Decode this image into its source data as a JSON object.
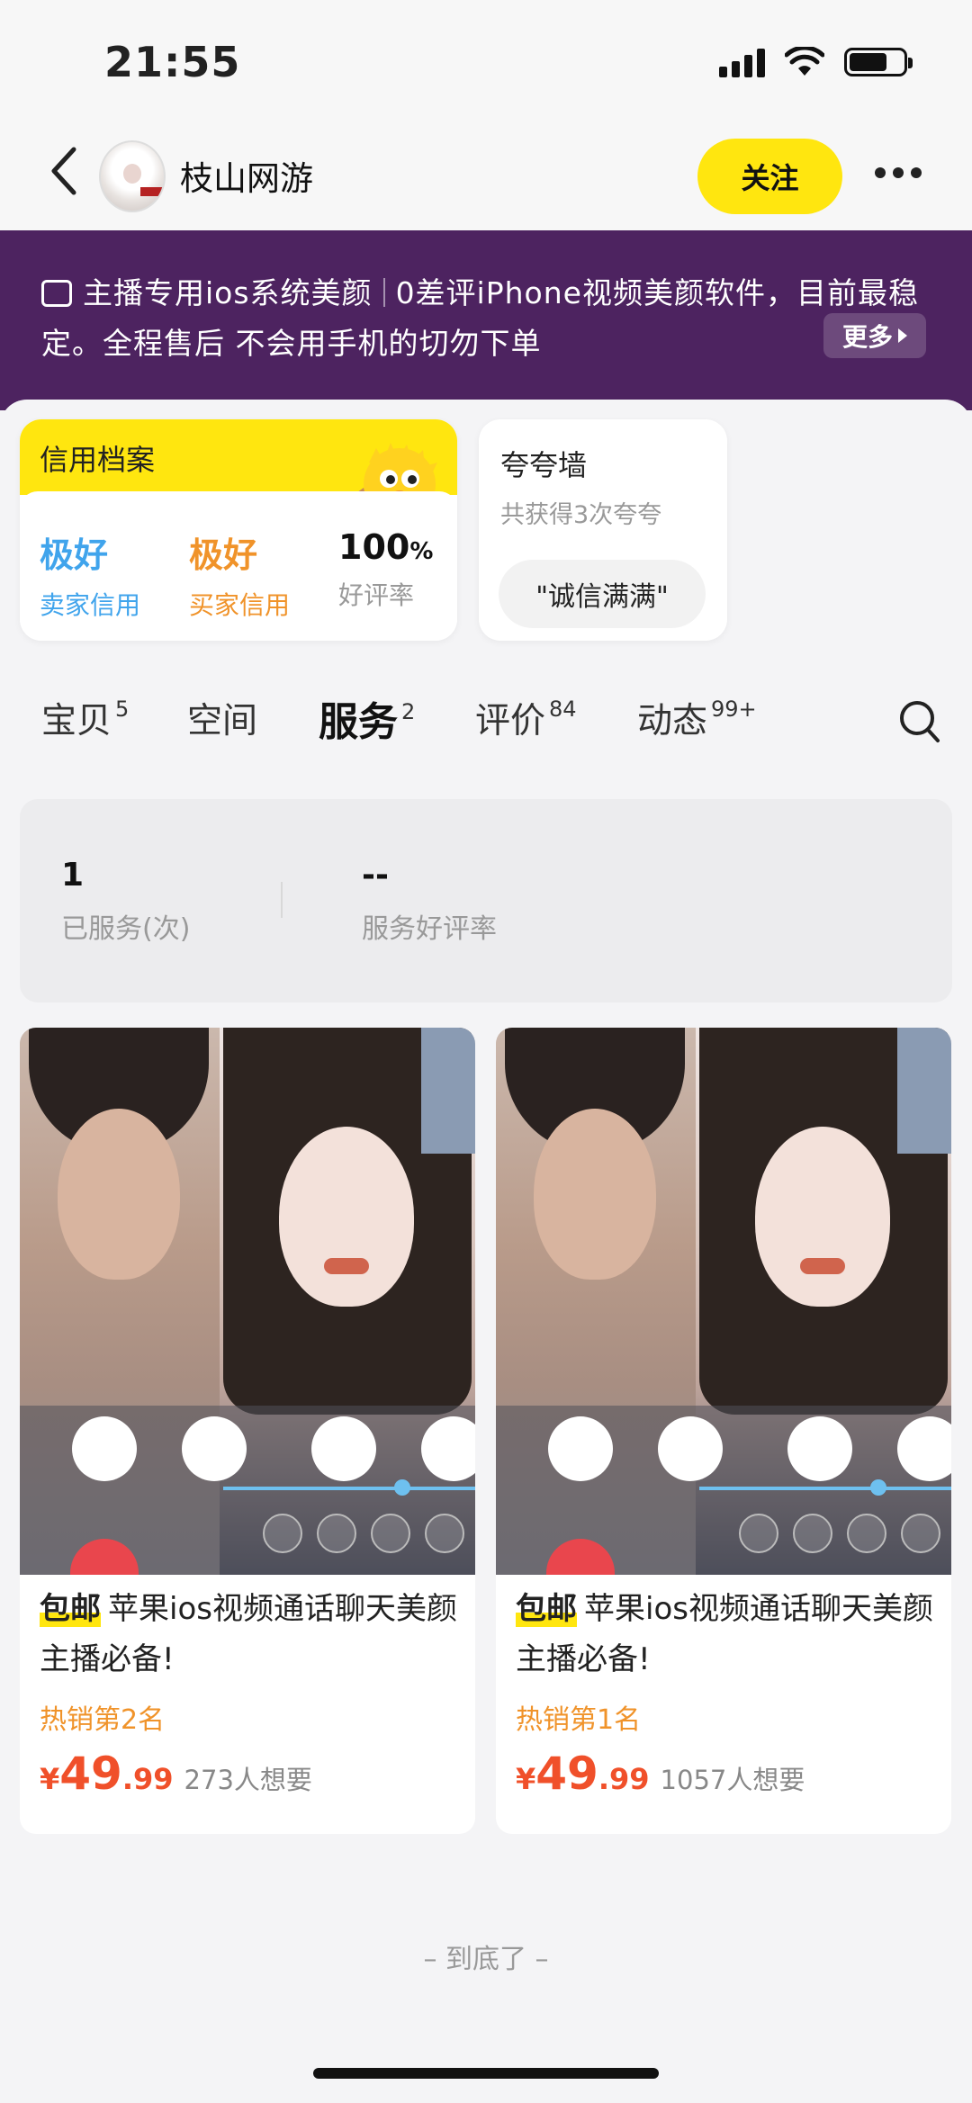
{
  "status_bar": {
    "time": "21:55"
  },
  "header": {
    "shop_name": "枝山网游",
    "follow_label": "关注"
  },
  "banner": {
    "announcement_part1": "主播专用ios系统美颜",
    "announcement_part2": "0差评iPhone视频美颜软件，目前最稳定。全程售后 不会用手机的切勿下单",
    "more_label": "更多"
  },
  "credit": {
    "title": "信用档案",
    "seller": {
      "value": "极好",
      "label": "卖家信用"
    },
    "buyer": {
      "value": "极好",
      "label": "买家信用"
    },
    "rating": {
      "value": "100",
      "unit": "%",
      "label": "好评率"
    }
  },
  "praise_wall": {
    "title": "夸夸墙",
    "subtitle": "共获得3次夸夸",
    "pill": "\"诚信满满\""
  },
  "tabs": [
    {
      "label": "宝贝",
      "count": "5"
    },
    {
      "label": "空间",
      "count": ""
    },
    {
      "label": "服务",
      "count": "2"
    },
    {
      "label": "评价",
      "count": "84"
    },
    {
      "label": "动态",
      "count": "99+"
    }
  ],
  "active_tab": "服务",
  "service_stats": {
    "served": {
      "value": "1",
      "label": "已服务(次)"
    },
    "rate": {
      "value": "--",
      "label": "服务好评率"
    }
  },
  "products": [
    {
      "tag": "包邮",
      "title": "苹果ios视频通话聊天美颜主播必备!",
      "rank": "热销第2名",
      "currency": "¥",
      "price_int": "49",
      "price_dec": ".99",
      "wants": "273人想要"
    },
    {
      "tag": "包邮",
      "title": "苹果ios视频通话聊天美颜主播必备!",
      "rank": "热销第1名",
      "currency": "¥",
      "price_int": "49",
      "price_dec": ".99",
      "wants": "1057人想要"
    }
  ],
  "footer_note": "– 到底了 –",
  "colors": {
    "accent_yellow": "#ffe60f",
    "banner_purple": "#4d2360",
    "price_red": "#f0502a"
  }
}
